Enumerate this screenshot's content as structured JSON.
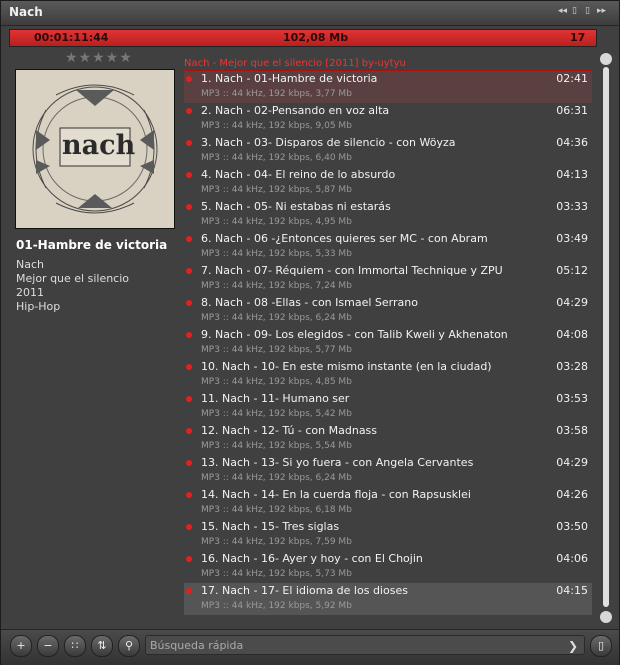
{
  "window": {
    "title": "Nach"
  },
  "status": {
    "elapsed": "00:01:11:44",
    "size": "102,08 Mb",
    "count": "17"
  },
  "rating": {
    "stars": "★★★★★"
  },
  "album": {
    "cover_text": "nach",
    "current_track": "01-Hambre de victoria",
    "artist": "Nach",
    "name": "Mejor que el silencio",
    "year": "2011",
    "genre": "Hip-Hop"
  },
  "playlist_header": "Nach - Mejor que el silencio [2011] by-uytyu",
  "tracks": [
    {
      "title": "1. Nach - 01-Hambre de victoria",
      "duration": "02:41",
      "info": "MP3 :: 44 kHz, 192 kbps, 3,77 Mb"
    },
    {
      "title": "2. Nach - 02-Pensando en voz alta",
      "duration": "06:31",
      "info": "MP3 :: 44 kHz, 192 kbps, 9,05 Mb"
    },
    {
      "title": "3. Nach - 03- Disparos de silencio - con Wöyza",
      "duration": "04:36",
      "info": "MP3 :: 44 kHz, 192 kbps, 6,40 Mb"
    },
    {
      "title": "4. Nach - 04- El reino de lo absurdo",
      "duration": "04:13",
      "info": "MP3 :: 44 kHz, 192 kbps, 5,87 Mb"
    },
    {
      "title": "5. Nach - 05- Ni estabas ni estarás",
      "duration": "03:33",
      "info": "MP3 :: 44 kHz, 192 kbps, 4,95 Mb"
    },
    {
      "title": "6. Nach - 06 -¿Entonces quieres ser MC - con Abram",
      "duration": "03:49",
      "info": "MP3 :: 44 kHz, 192 kbps, 5,33 Mb"
    },
    {
      "title": "7. Nach - 07- Réquiem - con Immortal Technique y ZPU",
      "duration": "05:12",
      "info": "MP3 :: 44 kHz, 192 kbps, 7,24 Mb"
    },
    {
      "title": "8. Nach - 08 -Ellas - con Ismael Serrano",
      "duration": "04:29",
      "info": "MP3 :: 44 kHz, 192 kbps, 6,24 Mb"
    },
    {
      "title": "9. Nach - 09- Los elegidos - con Talib Kweli y Akhenaton",
      "duration": "04:08",
      "info": "MP3 :: 44 kHz, 192 kbps, 5,77 Mb"
    },
    {
      "title": "10. Nach - 10- En este mismo instante (en la ciudad)",
      "duration": "03:28",
      "info": "MP3 :: 44 kHz, 192 kbps, 4,85 Mb"
    },
    {
      "title": "11. Nach - 11- Humano ser",
      "duration": "03:53",
      "info": "MP3 :: 44 kHz, 192 kbps, 5,42 Mb"
    },
    {
      "title": "12. Nach - 12- Tú - con Madnass",
      "duration": "03:58",
      "info": "MP3 :: 44 kHz, 192 kbps, 5,54 Mb"
    },
    {
      "title": "13. Nach - 13- Si yo fuera - con Angela Cervantes",
      "duration": "04:29",
      "info": "MP3 :: 44 kHz, 192 kbps, 6,24 Mb"
    },
    {
      "title": "14. Nach - 14- En la cuerda floja - con Rapsusklei",
      "duration": "04:26",
      "info": "MP3 :: 44 kHz, 192 kbps, 6,18 Mb"
    },
    {
      "title": "15. Nach - 15- Tres siglas",
      "duration": "03:50",
      "info": "MP3 :: 44 kHz, 192 kbps, 7,59 Mb"
    },
    {
      "title": "16. Nach - 16- Ayer y hoy - con El Chojin",
      "duration": "04:06",
      "info": "MP3 :: 44 kHz, 192 kbps, 5,73 Mb"
    },
    {
      "title": "17. Nach - 17- El idioma de los dioses",
      "duration": "04:15",
      "info": "MP3 :: 44 kHz, 192 kbps, 5,92 Mb"
    }
  ],
  "search": {
    "placeholder": "Búsqueda rápida"
  },
  "colors": {
    "accent": "#e32020",
    "background": "#404040"
  },
  "icons": {
    "add": "plus-icon",
    "remove": "minus-icon",
    "select": "select-icon",
    "sort": "sort-icon",
    "search": "magnifier-icon",
    "menu": "file-icon"
  }
}
